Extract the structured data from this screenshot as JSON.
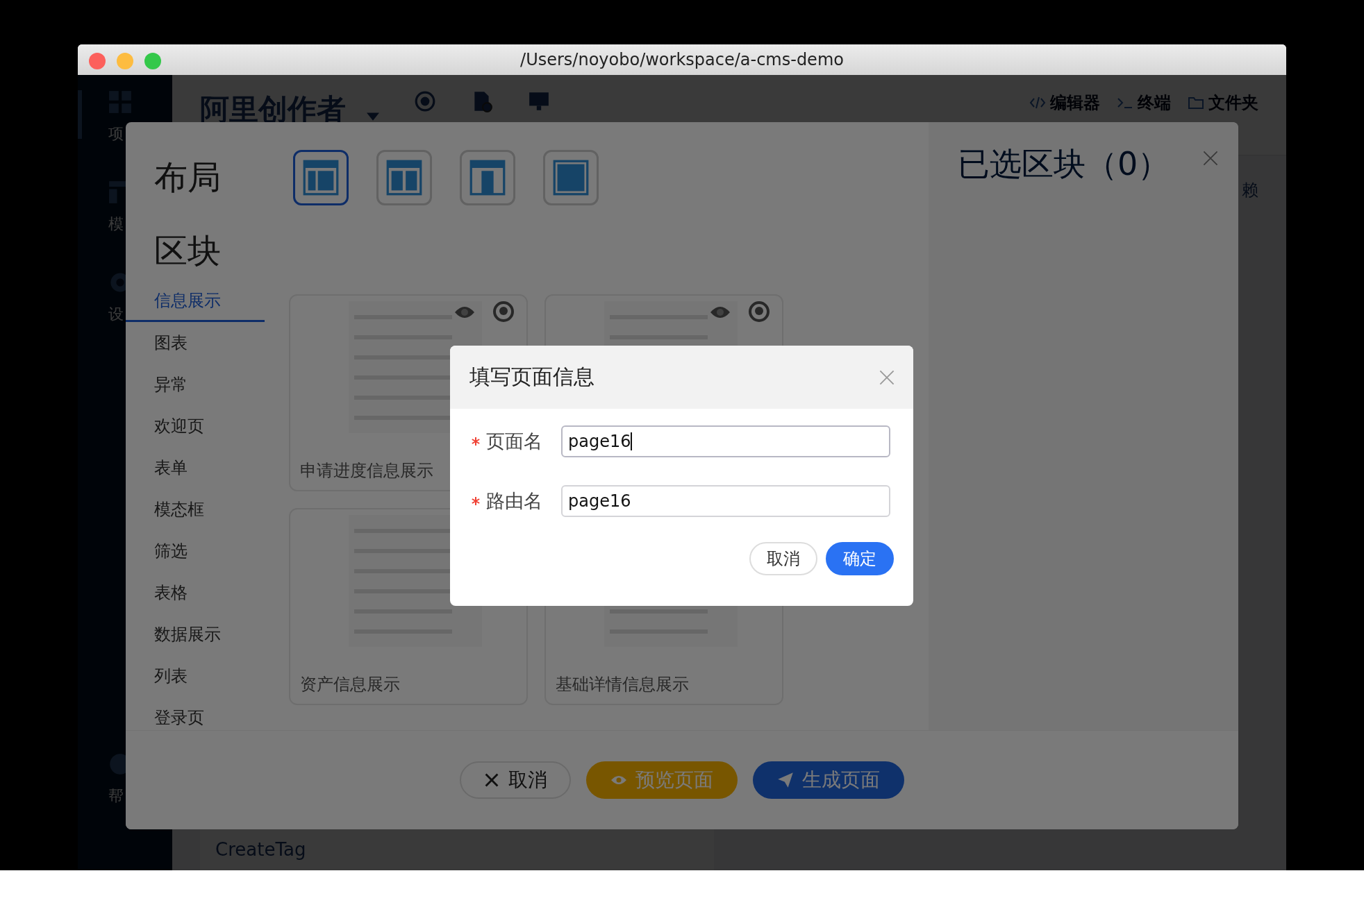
{
  "window": {
    "title": "/Users/noyobo/workspace/a-cms-demo"
  },
  "app_sidebar": {
    "items": [
      {
        "kind": "grid",
        "label": "项"
      },
      {
        "kind": "table",
        "label": "模"
      },
      {
        "kind": "gear",
        "label": "设"
      },
      {
        "kind": "help",
        "label": "帮"
      }
    ]
  },
  "app_header": {
    "title": "阿里创作者",
    "links": [
      {
        "kind": "code",
        "label": "编辑器"
      },
      {
        "kind": "terminal",
        "label": "终端"
      },
      {
        "kind": "folder",
        "label": "文件夹"
      }
    ]
  },
  "background": {
    "tab_fragment": "赖",
    "list_item": "CreateTag"
  },
  "block_picker": {
    "layout_heading": "布局",
    "layouts": [
      {
        "kind": "sidebar-left",
        "selected": true
      },
      {
        "kind": "two-column",
        "selected": false
      },
      {
        "kind": "sidebar-right",
        "selected": false
      },
      {
        "kind": "full",
        "selected": false
      }
    ],
    "blocks_heading": "区块",
    "categories": [
      {
        "label": "信息展示",
        "selected": true
      },
      {
        "label": "图表",
        "selected": false
      },
      {
        "label": "异常",
        "selected": false
      },
      {
        "label": "欢迎页",
        "selected": false
      },
      {
        "label": "表单",
        "selected": false
      },
      {
        "label": "模态框",
        "selected": false
      },
      {
        "label": "筛选",
        "selected": false
      },
      {
        "label": "表格",
        "selected": false
      },
      {
        "label": "数据展示",
        "selected": false
      },
      {
        "label": "列表",
        "selected": false
      },
      {
        "label": "登录页",
        "selected": false
      }
    ],
    "cards": [
      {
        "title": "申请进度信息展示",
        "actions": true
      },
      {
        "actions": true
      },
      {
        "title": "资产信息展示",
        "actions": false
      },
      {
        "title": "基础详情信息展示",
        "actions": false
      }
    ],
    "selected_heading": "已选区块（0）",
    "footer_buttons": [
      {
        "kind": "cancel",
        "label": "取消"
      },
      {
        "kind": "preview",
        "label": "预览页面"
      },
      {
        "kind": "generate",
        "label": "生成页面"
      }
    ]
  },
  "dialog": {
    "title": "填写页面信息",
    "fields": [
      {
        "label": "页面名",
        "value": "page16",
        "required": true,
        "focused": true
      },
      {
        "label": "路由名",
        "value": "page16",
        "required": true,
        "focused": false
      }
    ],
    "buttons": [
      {
        "label": "取消",
        "primary": false
      },
      {
        "label": "确定",
        "primary": true
      }
    ]
  }
}
